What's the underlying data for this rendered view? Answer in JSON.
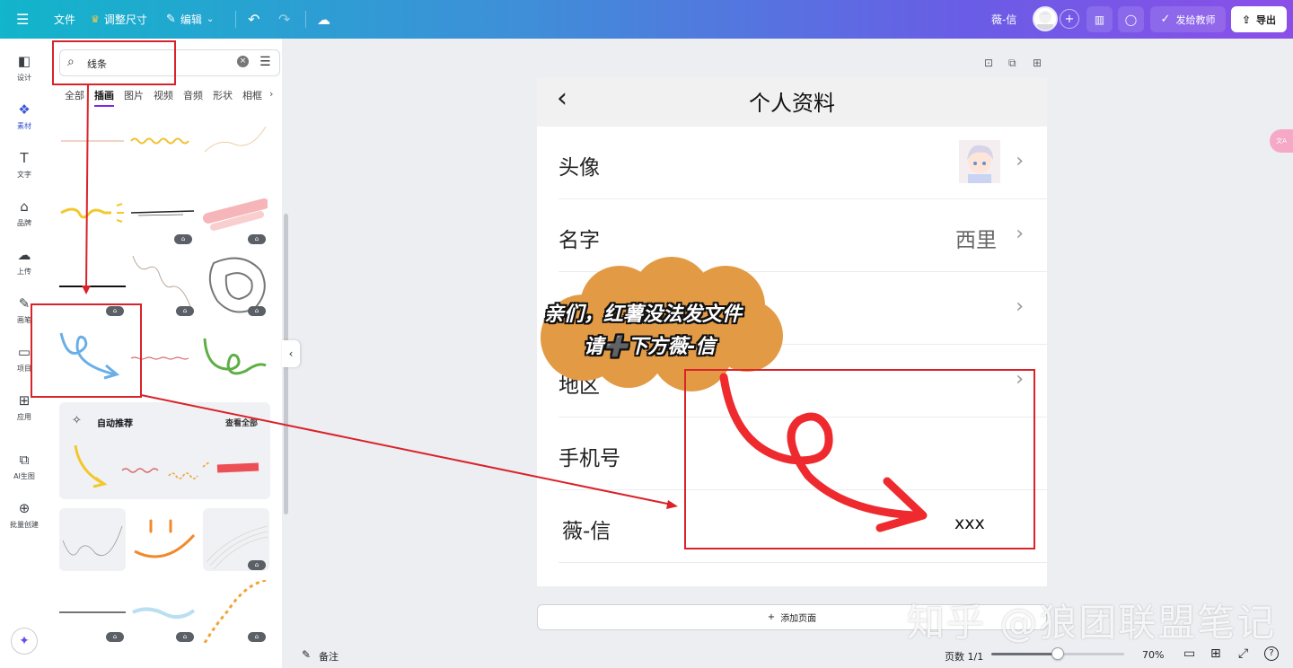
{
  "topbar": {
    "file": "文件",
    "resize": "调整尺寸",
    "edit": "编辑",
    "doc_name": "薇-信",
    "send_teacher": "发给教师",
    "export": "导出"
  },
  "rail": {
    "items": [
      {
        "label": "设计",
        "icon": "layout-icon"
      },
      {
        "label": "素材",
        "icon": "shapes-icon"
      },
      {
        "label": "文字",
        "icon": "text-icon"
      },
      {
        "label": "品牌",
        "icon": "brand-icon"
      },
      {
        "label": "上传",
        "icon": "upload-cloud-icon"
      },
      {
        "label": "画笔",
        "icon": "pen-icon"
      },
      {
        "label": "项目",
        "icon": "folder-icon"
      },
      {
        "label": "应用",
        "icon": "apps-icon"
      },
      {
        "label": "AI生图",
        "icon": "ai-image-icon"
      },
      {
        "label": "批量创建",
        "icon": "bulk-create-icon"
      }
    ]
  },
  "panel": {
    "search_value": "线条",
    "tabs": [
      "全部",
      "插画",
      "图片",
      "视频",
      "音频",
      "形状",
      "相框"
    ],
    "active_tab": "插画",
    "recommend_title": "自动推荐",
    "view_all": "查看全部"
  },
  "canvas": {
    "title": "个人资料",
    "rows": [
      {
        "label": "头像",
        "value": ""
      },
      {
        "label": "名字",
        "value": "西里"
      },
      {
        "label": "",
        "value": ""
      },
      {
        "label": "地区",
        "value": ""
      },
      {
        "label": "手机号",
        "value": ""
      },
      {
        "label": "薇-信",
        "value": "xxx"
      }
    ],
    "cloud_line1": "亲们，红薯没法发文件",
    "cloud_line2": "请➕下方薇-信",
    "add_page": "添加页面"
  },
  "bottom": {
    "notes": "备注",
    "page_count": "页数 1/1",
    "zoom": "70%",
    "zoom_fraction": 0.5
  },
  "watermark": "知乎 @狼团联盟笔记",
  "colors": {
    "accent": "#7d2ae8",
    "annotation_red": "#d9232a",
    "cloud_orange": "#e39a45"
  }
}
